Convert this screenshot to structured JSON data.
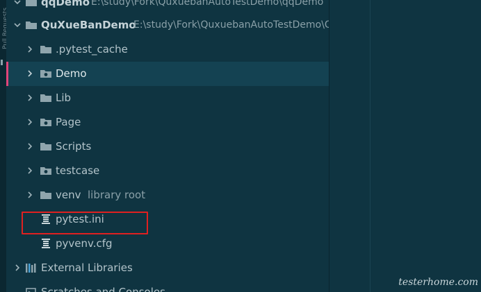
{
  "left_strip": {
    "label": "Pull Requests"
  },
  "tree": {
    "rows": [
      {
        "label": "qqDemo",
        "path": "E:\\study\\Fork\\QuxuebanAutoTestDemo\\qqDemo",
        "expanded": true
      },
      {
        "label": "QuXueBanDemo",
        "path": "E:\\study\\Fork\\QuxuebanAutoTestDemo\\QuXueBanDemo",
        "expanded": true
      },
      {
        "label": ".pytest_cache",
        "icon": "folder-icon"
      },
      {
        "label": "Demo",
        "icon": "package-folder-icon",
        "selected": true
      },
      {
        "label": "Lib",
        "icon": "folder-icon"
      },
      {
        "label": "Page",
        "icon": "package-folder-icon"
      },
      {
        "label": "Scripts",
        "icon": "folder-icon"
      },
      {
        "label": "testcase",
        "icon": "package-folder-icon"
      },
      {
        "label": "venv",
        "suffix": "library root",
        "icon": "folder-icon"
      },
      {
        "label": "pytest.ini",
        "icon": "config-file-icon",
        "highlighted": true
      },
      {
        "label": "pyvenv.cfg",
        "icon": "config-file-icon"
      },
      {
        "label": "External Libraries",
        "icon": "libraries-icon"
      },
      {
        "label": "Scratches and Consoles",
        "icon": "scratches-icon"
      }
    ]
  },
  "watermark": "testerhome.com",
  "colors": {
    "background": "#0f3441",
    "selection": "#144252",
    "selection_marker": "#e0457a",
    "highlight_border": "#e02020",
    "text": "#b3c4ca",
    "icon": "#8fa5ad"
  }
}
